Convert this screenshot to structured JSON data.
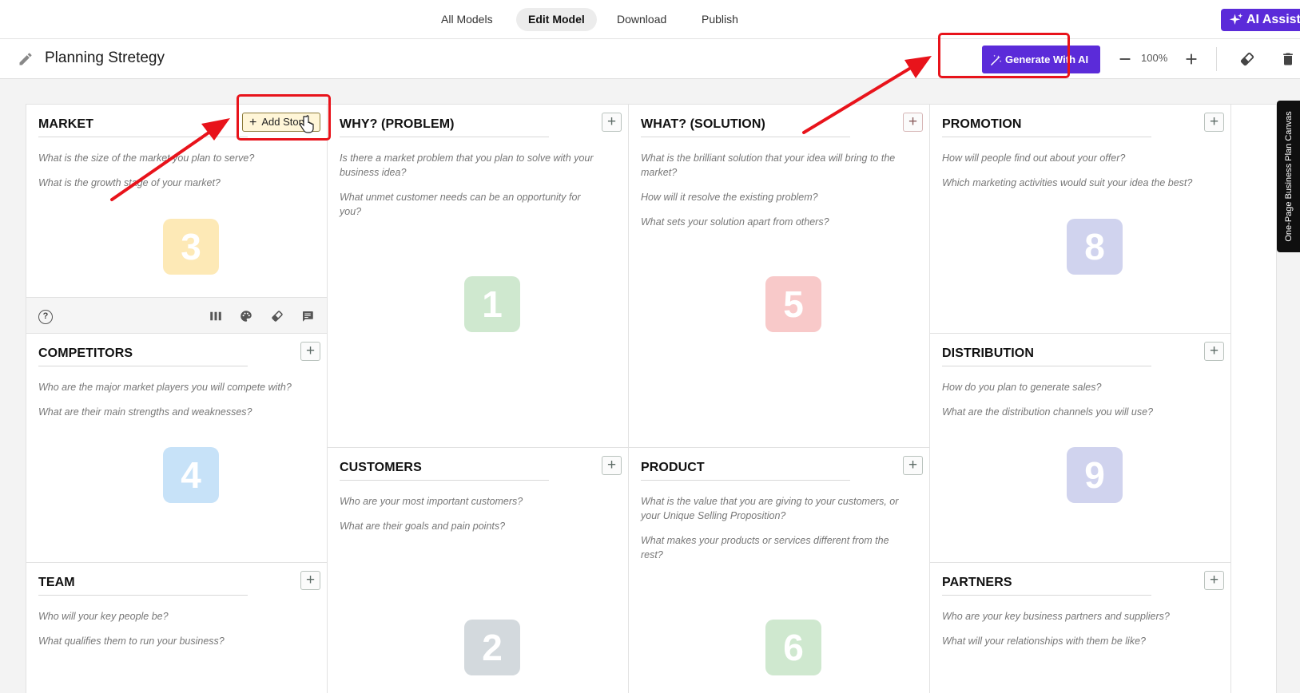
{
  "nav": {
    "tabs": [
      {
        "label": "All Models"
      },
      {
        "label": "Edit Model"
      },
      {
        "label": "Download"
      },
      {
        "label": "Publish"
      }
    ],
    "ai_assist_label": "AI Assist"
  },
  "toolbar": {
    "title": "Planning Stretegy",
    "generate_label": "Generate With AI",
    "zoom": "100%"
  },
  "side_tab_label": "One-Page Business Plan Canvas",
  "colors": {
    "accent": "#5b2bd9",
    "annotation": "#e8131b",
    "badge_yellow": "#fde9b6",
    "badge_green": "#cfe8cf",
    "badge_pink": "#f8c9c9",
    "badge_purple": "#d0d3ee",
    "badge_blue": "#c7e2f8",
    "badge_gray": "#d3d9dd"
  },
  "cells": {
    "market": {
      "title": "MARKET",
      "add_label": "Add Story",
      "prompts": [
        "What is the size of the market you plan to serve?",
        "What is the growth stage of your market?"
      ],
      "number": "3"
    },
    "problem": {
      "title": "WHY? (PROBLEM)",
      "prompts": [
        "Is there a market problem that you plan to solve with your business idea?",
        "What unmet customer needs can be an opportunity for you?"
      ],
      "number": "1"
    },
    "solution": {
      "title": "WHAT? (SOLUTION)",
      "prompts": [
        "What is the brilliant solution that your idea will bring to the market?",
        "How will it resolve the existing problem?",
        "What sets your solution apart from others?"
      ],
      "number": "5"
    },
    "promotion": {
      "title": "PROMOTION",
      "prompts": [
        "How will people find out about your offer?",
        "Which marketing activities would suit your idea the best?"
      ],
      "number": "8"
    },
    "competitors": {
      "title": "COMPETITORS",
      "prompts": [
        "Who are the major market players you will compete with?",
        "What are their main strengths and weaknesses?"
      ],
      "number": "4"
    },
    "distribution": {
      "title": "DISTRIBUTION",
      "prompts": [
        "How do you plan to generate sales?",
        "What are the distribution channels you will use?"
      ],
      "number": "9"
    },
    "customers": {
      "title": "CUSTOMERS",
      "prompts": [
        "Who are your most important customers?",
        "What are their goals and pain points?"
      ],
      "number": "2"
    },
    "product": {
      "title": "PRODUCT",
      "prompts": [
        "What is the value that you are giving to your customers, or your Unique Selling Proposition?",
        "What makes your products or services different from the rest?"
      ],
      "number": "6"
    },
    "team": {
      "title": "TEAM",
      "prompts": [
        "Who will your key people be?",
        "What qualifies them to run your business?"
      ]
    },
    "partners": {
      "title": "PARTNERS",
      "prompts": [
        "Who are your key business partners and suppliers?",
        "What will your relationships with them be like?"
      ]
    }
  }
}
